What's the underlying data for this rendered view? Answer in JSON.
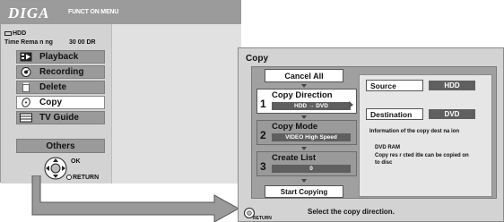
{
  "function_menu": {
    "logo": "DIGA",
    "title": "FUNCT ON MENU",
    "drive_label": "HDD",
    "time_label": "Time Rema n ng",
    "time_value": "30 00 DR",
    "items": [
      {
        "label": "Playback",
        "icon": "playback-icon",
        "selected": false
      },
      {
        "label": "Recording",
        "icon": "recording-icon",
        "selected": false
      },
      {
        "label": "Delete",
        "icon": "delete-icon",
        "selected": false
      },
      {
        "label": "Copy",
        "icon": "copy-disc-icon",
        "selected": true
      },
      {
        "label": "TV Guide",
        "icon": "tv-guide-icon",
        "selected": false
      }
    ],
    "others_label": "Others",
    "ok_label": "OK",
    "return_label": "RETURN"
  },
  "copy_dialog": {
    "title": "Copy",
    "cancel_label": "Cancel All",
    "steps": [
      {
        "num": "1",
        "label": "Copy Direction",
        "value": "HDD → DVD",
        "active": true
      },
      {
        "num": "2",
        "label": "Copy Mode",
        "value": "VIDEO  High Speed",
        "active": false
      },
      {
        "num": "3",
        "label": "Create List",
        "value": "0",
        "active": false
      }
    ],
    "start_label": "Start Copying",
    "source_label": "Source",
    "source_value": "HDD",
    "destination_label": "Destination",
    "destination_value": "DVD",
    "info_heading": "Information of the copy dest na ion",
    "info_line1": "DVD RAM",
    "info_line2": "Copy res r cted  itle can be copied on to disc",
    "hint": "Select the copy direction.",
    "return_label": "RETURN"
  },
  "colors": {
    "panel_bg": "#d3d3d3",
    "header_bg": "#9b9b9b",
    "value_bg": "#5f5f5f",
    "selected_bg": "#ffffff"
  }
}
